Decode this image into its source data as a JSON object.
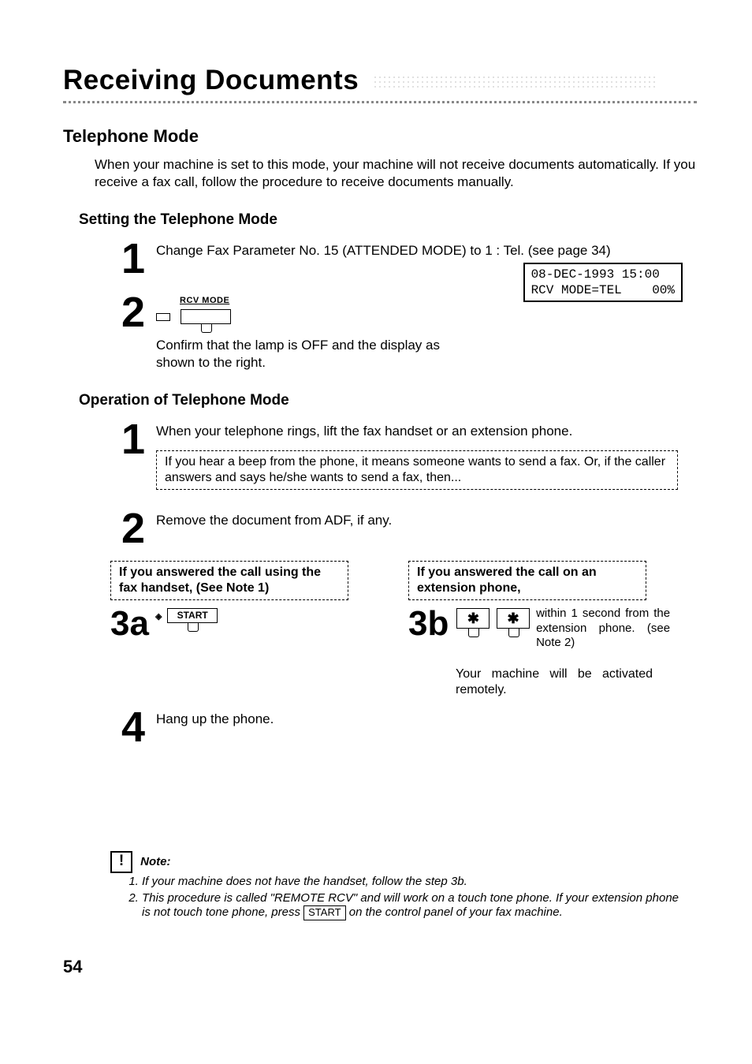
{
  "header": {
    "title": "Receiving Documents"
  },
  "section1": {
    "title": "Telephone Mode",
    "intro": "When your machine is set to this mode, your machine will not receive documents automatically. If you receive a fax call, follow the procedure to receive documents manually."
  },
  "setting": {
    "title": "Setting the Telephone Mode",
    "steps": {
      "s1": {
        "num": "1",
        "text": "Change Fax Parameter No. 15 (ATTENDED MODE) to 1 : Tel. (see page 34)"
      },
      "s2": {
        "num": "2",
        "rcv_label": "RCV MODE",
        "text": "Confirm that the lamp is OFF and the display as shown to the right."
      }
    },
    "lcd": {
      "line1": "08-DEC-1993 15:00",
      "line2": "RCV MODE=TEL    00%"
    }
  },
  "operation": {
    "title": "Operation of Telephone Mode",
    "s1": {
      "num": "1",
      "text": "When your telephone rings, lift the fax handset or an extension phone.",
      "box": "If you hear a beep from the phone, it means someone wants to send a fax. Or, if the caller answers and says he/she wants to send a fax, then..."
    },
    "s2": {
      "num": "2",
      "text": "Remove the document from ADF, if any."
    },
    "s3a": {
      "num": "3a",
      "box": "If you answered the call using the fax handset, (See Note 1)",
      "key": "START"
    },
    "s3b": {
      "num": "3b",
      "box": "If you answered the call on an extension phone,",
      "key": "✱",
      "aside": "within 1 second from the extension phone. (see Note 2)",
      "remote": "Your machine will be activated remotely."
    },
    "s4": {
      "num": "4",
      "text": "Hang up the phone."
    }
  },
  "notes": {
    "label": "Note:",
    "n1": "If your machine does not have the handset, follow the step 3b.",
    "n2a": "This procedure is called \"REMOTE RCV\" and will work on a touch tone phone.  If your extension phone is not touch tone phone, press ",
    "n2key": "START",
    "n2b": " on the control panel of your fax machine."
  },
  "page_number": "54"
}
